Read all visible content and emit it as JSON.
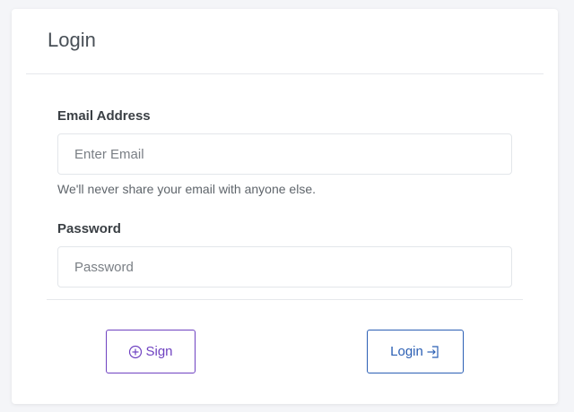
{
  "card": {
    "title": "Login"
  },
  "form": {
    "email": {
      "label": "Email Address",
      "placeholder": "Enter Email",
      "value": "",
      "help": "We'll never share your email with anyone else."
    },
    "password": {
      "label": "Password",
      "placeholder": "Password",
      "value": ""
    }
  },
  "actions": {
    "sign_label": "Sign",
    "sign_icon": "plus-circle-icon",
    "login_label": "Login",
    "login_icon": "login-enter-icon"
  },
  "colors": {
    "sign_accent": "#6f42c1",
    "login_accent": "#2b5fb4",
    "border": "#e3e6ea"
  }
}
